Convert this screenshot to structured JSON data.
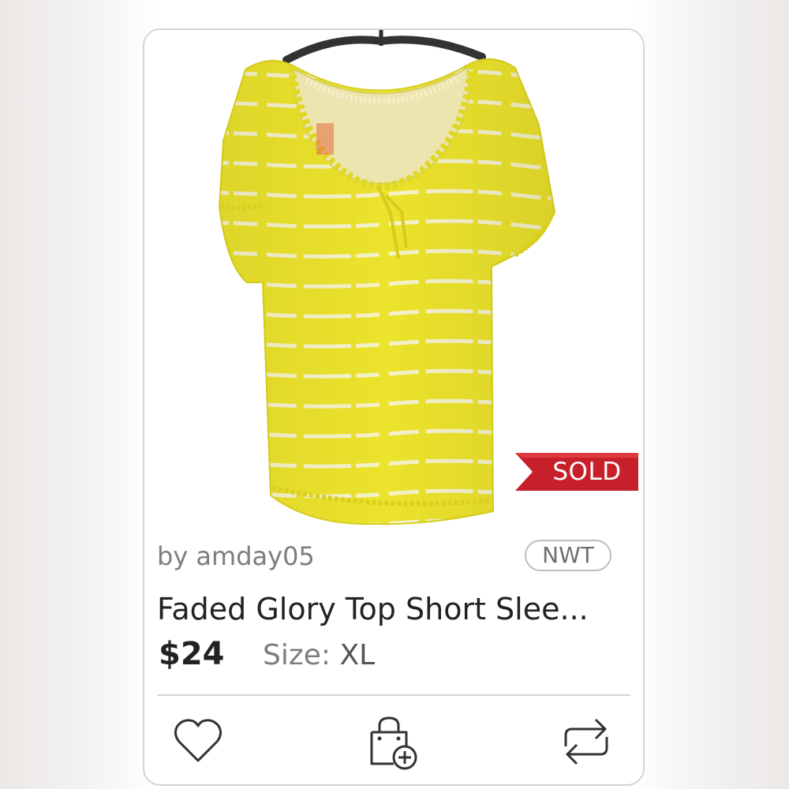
{
  "listing": {
    "seller": "by amday05",
    "condition_badge": "NWT",
    "title": "Faded Glory Top Short Slee...",
    "price": "$24",
    "size_label": "Size:",
    "size_value": "XL",
    "status_banner": "SOLD"
  },
  "actions": [
    {
      "name": "like",
      "icon": "heart-icon"
    },
    {
      "name": "add-to-bundle",
      "icon": "shopping-bag-plus-icon"
    },
    {
      "name": "share",
      "icon": "share-loop-icon"
    }
  ],
  "colors": {
    "sold_banner": "#c8202a",
    "shirt": "#ece32c",
    "text_primary": "#222222",
    "text_secondary": "#7d7d7d"
  }
}
